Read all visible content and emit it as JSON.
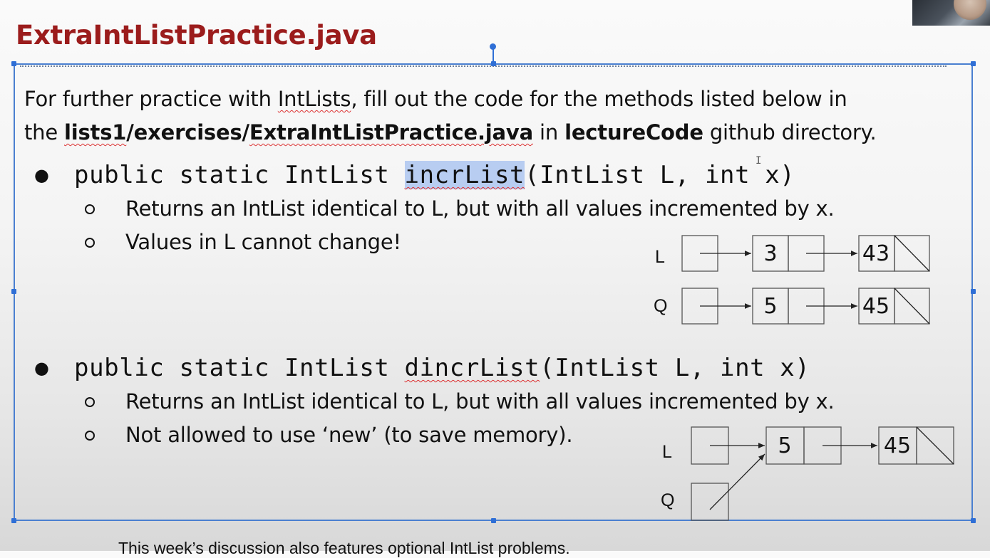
{
  "slide": {
    "title": "ExtraIntListPractice.java",
    "intro": {
      "line1_prefix": "For further practice with ",
      "line1_intlists": "IntLists",
      "line1_suffix": ", fill out the code for the methods listed below in",
      "line2_prefix": "the ",
      "line2_path_a": "lists1",
      "line2_path_b": "/exercises/",
      "line2_path_c": "ExtraIntListPractice.java",
      "line2_mid": " in ",
      "line2_repo": "lectureCode",
      "line2_suffix": " github directory."
    },
    "methods": [
      {
        "sig_prefix": "public static IntList ",
        "sig_name": "incrList",
        "sig_suffix": "(IntList L, int x)",
        "notes": [
          "Returns an IntList identical to L, but with all values incremented by x.",
          "Values in L cannot change!"
        ]
      },
      {
        "sig_prefix": "public static IntList ",
        "sig_name": "dincrList",
        "sig_suffix": "(IntList L, int x)",
        "notes": [
          "Returns an IntList identical to L, but with all values incremented by x.",
          "Not allowed to use ‘new’ (to save memory)."
        ]
      }
    ],
    "diagram1": {
      "label_l": "L",
      "label_q": "Q",
      "l_values": [
        "3",
        "43"
      ],
      "q_values": [
        "5",
        "45"
      ]
    },
    "diagram2": {
      "label_l": "L",
      "label_q": "Q",
      "values": [
        "5",
        "45"
      ]
    },
    "footer": "This week’s discussion also features optional IntList problems."
  },
  "colors": {
    "title": "#9b1c1c",
    "selection_handles": "#2f6fd6",
    "highlight": "#b8cdf1",
    "spellcheck": "#dd3333"
  },
  "icons": {
    "cursor": "text-cursor-icon",
    "bullet": "filled-circle-bullet-icon",
    "subbullet": "hollow-circle-bullet-icon"
  }
}
